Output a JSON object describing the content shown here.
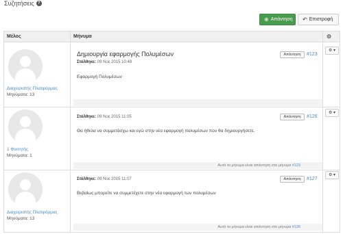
{
  "page": {
    "title": "Συζητήσεις"
  },
  "toolbar": {
    "reply_label": "Απάντηση",
    "back_label": "Επιστροφή"
  },
  "table": {
    "col_member": "Μέλος",
    "col_message": "Μήνυμα"
  },
  "posts": [
    {
      "member_name": "Διαχειριστής Πλατφόρμας",
      "member_count": "Μηνύματα: 13",
      "title": "Δημιουργία εφαρμογής Πολυμέσων",
      "sent_label": "Στάλθηκε:",
      "sent_date": "09 Νοε 2015 10:48",
      "body": "Εφαρμογή Πολυμέσων",
      "reply_label": "Απάντηση",
      "number": "#123",
      "in_reply": ""
    },
    {
      "member_name": "1 Φοιτητής",
      "member_count": "Μηνύματα: 1",
      "title": "",
      "sent_label": "Στάλθηκε:",
      "sent_date": "09 Νοε 2015 11:05",
      "body": "Θα ήθελα να συμμετάσχω και εγώ στην νέα εφαρμογή πολυμέσων που θα δημιουργήσετε.",
      "reply_label": "Απάντηση",
      "number": "#126",
      "in_reply_text": "Αυτό το μήνυμα είναι απάντηση στο μήνυμα",
      "in_reply_num": "#123"
    },
    {
      "member_name": "Διαχειριστής Πλατφόρμας",
      "member_count": "Μηνύματα: 13",
      "title": "",
      "sent_label": "Στάλθηκε:",
      "sent_date": "09 Νοε 2015 11:07",
      "body": "Βεβαίως μπορείτε να συμμετέχετε στην νέα εφαρμογή των πολυμέσων",
      "reply_label": "Απάντηση",
      "number": "#127",
      "in_reply_text": "Αυτό το μήνυμα είναι απάντηση στο μήνυμα",
      "in_reply_num": "#126"
    }
  ],
  "icons": {
    "help": "question-circle-icon",
    "reply": "plus-circle-icon",
    "back": "reply-arrow-icon",
    "gear": "gear-icon",
    "user": "user-placeholder-icon"
  }
}
